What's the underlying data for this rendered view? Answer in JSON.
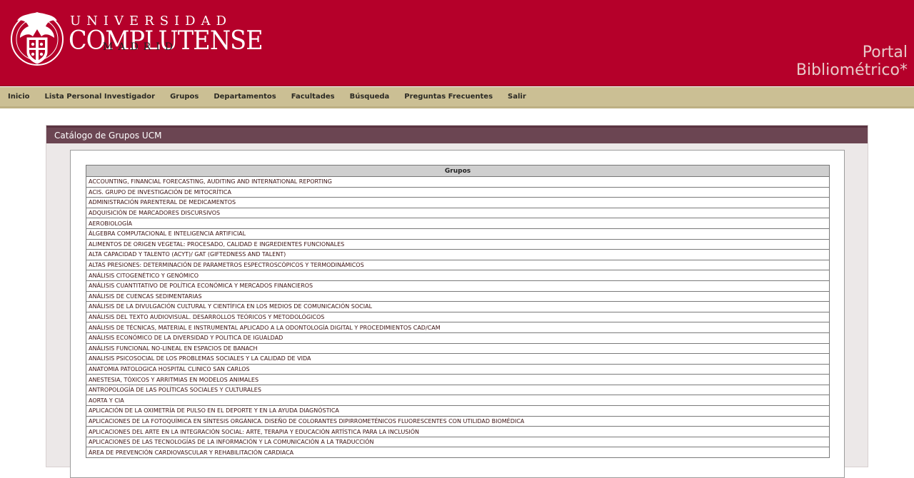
{
  "header": {
    "brand_top": "UNIVERSIDAD",
    "brand_main": "COMPLUTENSE",
    "brand_bottom": "MADRID",
    "portal_line1": "Portal",
    "portal_line2": "Bibliométrico*"
  },
  "nav": {
    "items": [
      {
        "label": "Inicio"
      },
      {
        "label": "Lista Personal Investigador"
      },
      {
        "label": "Grupos"
      },
      {
        "label": "Departamentos"
      },
      {
        "label": "Facultades"
      },
      {
        "label": "Búsqueda"
      },
      {
        "label": "Preguntas Frecuentes"
      },
      {
        "label": "Salir"
      }
    ]
  },
  "panel": {
    "title": "Catálogo de Grupos UCM",
    "table_header": "Grupos",
    "rows": [
      "ACCOUNTING, FINANCIAL FORECASTING, AUDITING AND INTERNATIONAL REPORTING",
      "ACIS. GRUPO DE INVESTIGACIÓN DE MITOCRÍTICA",
      "ADMINISTRACIÓN PARENTERAL DE MEDICAMENTOS",
      "ADQUISICIÓN DE MARCADORES DISCURSIVOS",
      "AEROBIOLOGÍA",
      "ÁLGEBRA COMPUTACIONAL E INTELIGENCIA ARTIFICIAL",
      "ALIMENTOS DE ORIGEN VEGETAL: PROCESADO, CALIDAD E INGREDIENTES FUNCIONALES",
      "ALTA CAPACIDAD Y TALENTO (ACYT)/ GAT (GIFTEDNESS AND TALENT)",
      "ALTAS PRESIONES: DETERMINACIÓN DE PARAMETROS ESPECTROSCÓPICOS Y TERMODINÁMICOS",
      "ANÁLISIS CITOGENÉTICO Y GENÓMICO",
      "ANÁLISIS CUANTITATIVO DE POLÍTICA ECONÓMICA Y MERCADOS FINANCIEROS",
      "ANÁLISIS DE CUENCAS SEDIMENTARIAS",
      "ANÁLISIS DE LA DIVULGACIÓN CULTURAL Y CIENTÍFICA EN LOS MEDIOS DE COMUNICACIÓN SOCIAL",
      "ANÁLISIS DEL TEXTO AUDIOVISUAL. DESARROLLOS TEÓRICOS Y METODOLÓGICOS",
      "ANÁLISIS DE TÉCNICAS, MATERIAL E INSTRUMENTAL APLICADO A LA ODONTOLOGÍA DIGITAL Y PROCEDIMIENTOS CAD/CAM",
      "ANÁLISIS ECONÓMICO DE LA DIVERSIDAD Y POLITICA DE IGUALDAD",
      "ANÁLISIS FUNCIONAL NO-LINEAL EN ESPACIOS DE BANACH",
      "ANALISIS PSICOSOCIAL DE LOS PROBLEMAS SOCIALES Y LA CALIDAD DE VIDA",
      "ANATOMIA PATOLOGICA HOSPITAL CLINICO SAN CARLOS",
      "ANESTESIA, TÓXICOS Y ARRITMIAS EN MODELOS ANIMALES",
      "ANTROPOLOGÍA DE LAS POLÍTICAS SOCIALES Y CULTURALES",
      "AORTA Y CIA",
      "APLICACIÓN DE LA OXIMETRÍA DE PULSO EN EL DEPORTE Y EN LA AYUDA DIAGNÓSTICA",
      "APLICACIONES DE LA FOTOQUÍMICA EN SÍNTESIS ORGÁNICA. DISEÑO DE COLORANTES DIPIRROMETÉNICOS FLUORESCENTES CON UTILIDAD BIOMÉDICA",
      "APLICACIONES DEL ARTE EN LA INTEGRACIÓN SOCIAL: ARTE, TERAPIA Y EDUCACIÓN ARTÍSTICA PARA LA INCLUSIÓN",
      "APLICACIONES DE LAS TECNOLOGÍAS DE LA INFORMACIÓN Y LA COMUNICACIÓN A LA TRADUCCIÓN",
      "ÁREA DE PREVENCIÓN CARDIOVASCULAR Y REHABILITACIÓN CARDIACA"
    ]
  },
  "colors": {
    "header_bg": "#b5002a",
    "nav_bg": "#cbbf94",
    "panel_title_bg": "#6b4552"
  }
}
